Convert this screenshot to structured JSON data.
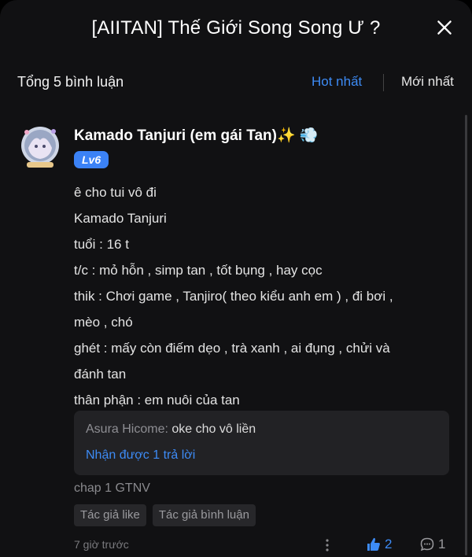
{
  "header": {
    "title": "[AIITAN] Thế Giới Song Song Ư ?"
  },
  "sortbar": {
    "count_label": "Tổng 5 bình luận",
    "hot_label": "Hot nhất",
    "new_label": "Mới nhất"
  },
  "comment": {
    "username": "Kamado Tanjuri (em gái Tan)",
    "emoji_sparkle": "✨",
    "emoji_dash": "💨",
    "level_badge": "Lv6",
    "lines": [
      "ê cho tui vô đi",
      "Kamado Tanjuri",
      "tuổi : 16 t",
      "t/c : mỏ hỗn , simp tan , tốt bụng , hay cọc",
      "thik : Chơi game , Tanjiro( theo kiểu anh em ) , đi bơi ,",
      "mèo , chó",
      "ghét : mấy còn điếm dẹo , trà xanh , ai đụng , chửi và",
      "đánh tan",
      "thân phận : em nuôi của tan"
    ],
    "reply_preview": {
      "user": "Asura Hicome",
      "text": " oke cho vô liền",
      "link_label": "Nhận được 1 trả lời"
    },
    "extra_text": "chap 1 GTNV",
    "tags": [
      "Tác giả like",
      "Tác giả bình luận"
    ],
    "time": "7 giờ trước",
    "like_count": "2",
    "reply_count": "1"
  },
  "colors": {
    "accent": "#3d8bf5",
    "background": "#111113",
    "badge": "#3b82f6"
  }
}
